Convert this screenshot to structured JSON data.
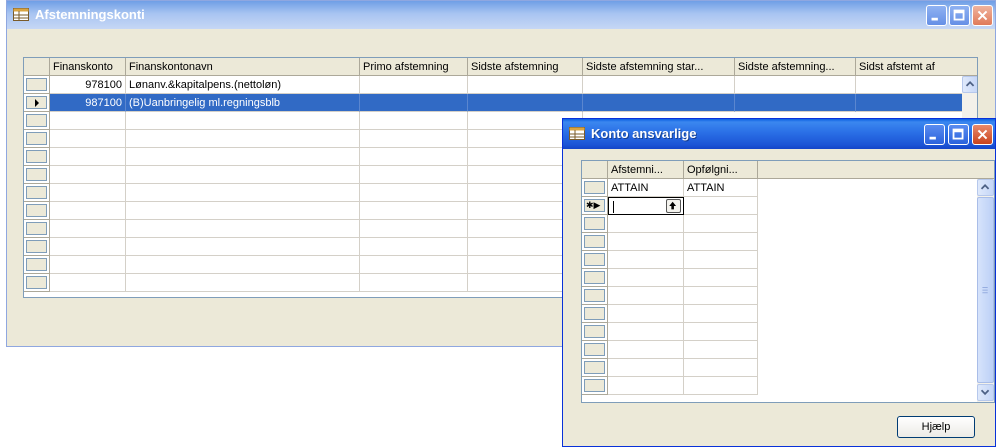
{
  "main_window": {
    "title": "Afstemningskonti",
    "columns": [
      "Finanskonto",
      "Finanskontonavn",
      "Primo afstemning",
      "Sidste afstemning",
      "Sidste afstemning star...",
      "Sidste afstemning...",
      "Sidst afstemt af"
    ],
    "rows": [
      {
        "konto": "978100",
        "navn": "Lønanv.&kapitalpens.(nettoløn)",
        "primo": "",
        "sidste": "",
        "start": "",
        "sidste2": "",
        "af": ""
      },
      {
        "konto": "987100",
        "navn": "(B)Uanbringelig ml.regningsblb",
        "primo": "",
        "sidste": "",
        "start": "",
        "sidste2": "",
        "af": ""
      }
    ],
    "selected_row": 1
  },
  "popup_window": {
    "title": "Konto ansvarlige",
    "columns": [
      "Afstemni...",
      "Opfølgni..."
    ],
    "rows": [
      {
        "afstem": "ATTAIN",
        "opfolg": "ATTAIN"
      }
    ],
    "new_row_marker": "✱▶",
    "help_button": "Hjælp"
  },
  "colors": {
    "selection": "#316ac5",
    "title_active": "#1c55d6",
    "title_inactive": "#a8c4f1"
  }
}
